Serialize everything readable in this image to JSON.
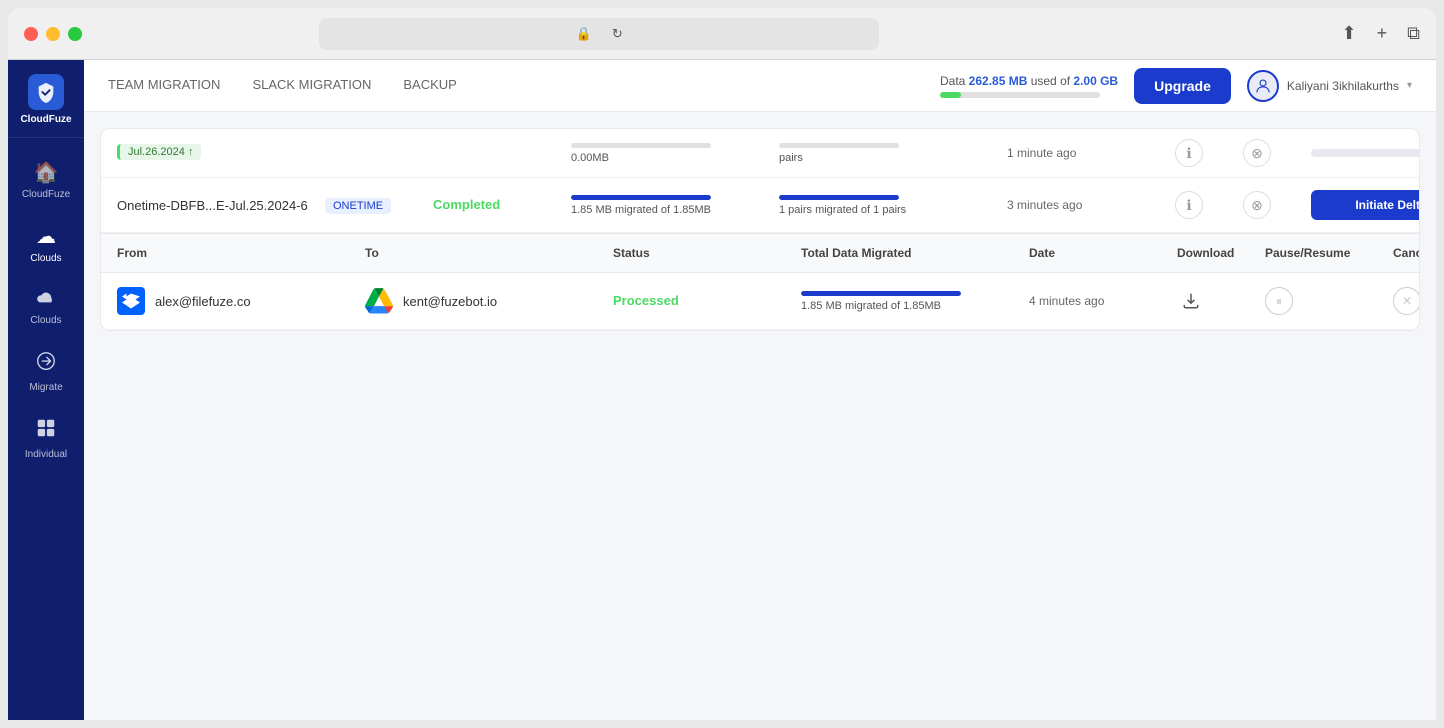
{
  "window": {
    "title": "CloudFuze",
    "url_placeholder": ""
  },
  "sidebar": {
    "logo_text": "CloudFuze",
    "items": [
      {
        "id": "cloudfuze",
        "label": "CloudFuze",
        "icon": "🔄"
      },
      {
        "id": "clouds1",
        "label": "Clouds",
        "icon": "☁"
      },
      {
        "id": "clouds2",
        "label": "Clouds",
        "icon": "☁"
      },
      {
        "id": "migrate",
        "label": "Migrate",
        "icon": "🚀"
      },
      {
        "id": "individual",
        "label": "Individual",
        "icon": "🗄"
      }
    ]
  },
  "top_nav": {
    "tabs": [
      {
        "id": "team-migration",
        "label": "TEAM MIGRATION",
        "active": false
      },
      {
        "id": "slack-migration",
        "label": "SLACK MIGRATION",
        "active": false
      },
      {
        "id": "backup",
        "label": "BACKUP",
        "active": false
      }
    ],
    "data_usage_label": "Data ",
    "data_used": "262.85 MB",
    "data_used_suffix": " used of ",
    "data_total": "2.00 GB",
    "upgrade_label": "Upgrade",
    "user_name": "Kaliyani 3ikhilakurths"
  },
  "migration_top_row": {
    "date_tag": "Jul.26.2024 ↑",
    "type": "",
    "status": "",
    "data_size": "0.00MB",
    "pairs": "pairs",
    "time": "1 minute ago",
    "action_bar": ""
  },
  "migration_main_row": {
    "name": "Onetime-DBFB...E-Jul.25.2024-6",
    "type": "ONETIME",
    "status": "Completed",
    "data_progress": "1.85 MB migrated of 1.85MB",
    "pairs_progress": "1 pairs migrated of 1 pairs",
    "time": "3 minutes ago",
    "initiate_delta_label": "Initiate Delta"
  },
  "detail_table": {
    "headers": {
      "from": "From",
      "to": "To",
      "status": "Status",
      "total_data_migrated": "Total Data Migrated",
      "date": "Date",
      "download": "Download",
      "pause_resume": "Pause/Resume",
      "cancel": "Cancel"
    },
    "rows": [
      {
        "from_icon": "dropbox",
        "from_email": "alex@filefuze.co",
        "to_icon": "gdrive",
        "to_email": "kent@fuzebot.io",
        "status": "Processed",
        "data_bar_width": "100%",
        "data_migrated": "1.85 MB migrated of 1.85MB",
        "date": "4 minutes ago"
      }
    ]
  }
}
